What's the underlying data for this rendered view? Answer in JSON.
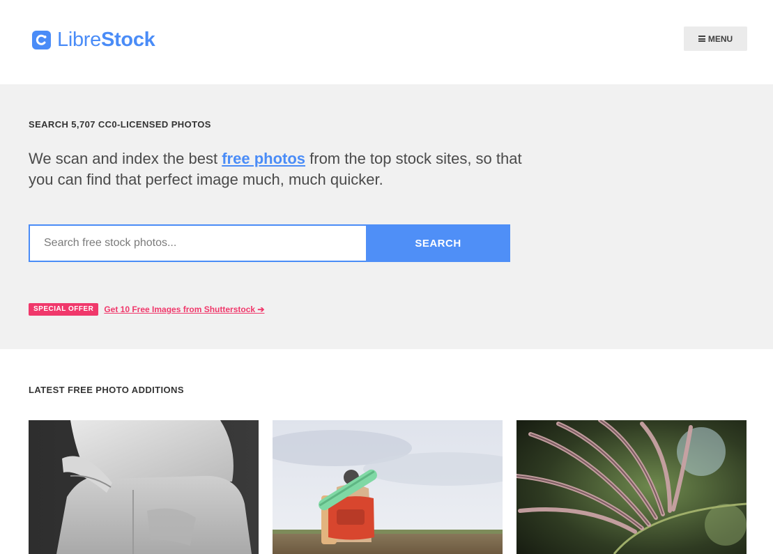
{
  "header": {
    "logo_part1": "Libre",
    "logo_part2": "Stock",
    "menu_label": "MENU",
    "brand_color": "#4a8cf7"
  },
  "hero": {
    "kicker": "SEARCH 5,707 CC0-LICENSED PHOTOS",
    "lead_before": "We scan and index the best ",
    "lead_link": "free photos",
    "lead_after": " from the top stock sites, so that you can find that perfect image much, much quicker.",
    "search_placeholder": "Search free stock photos...",
    "search_button": "SEARCH",
    "offer_badge": "SPECIAL OFFER",
    "offer_link": "Get 10 Free Images from Shutterstock ➔",
    "offer_color": "#f0386b"
  },
  "latest": {
    "title": "LATEST FREE PHOTO ADDITIONS",
    "photos": [
      {
        "subject": "black-and-white jeans photo"
      },
      {
        "subject": "hiker with backpack photo"
      },
      {
        "subject": "grass seed heads photo"
      }
    ]
  }
}
